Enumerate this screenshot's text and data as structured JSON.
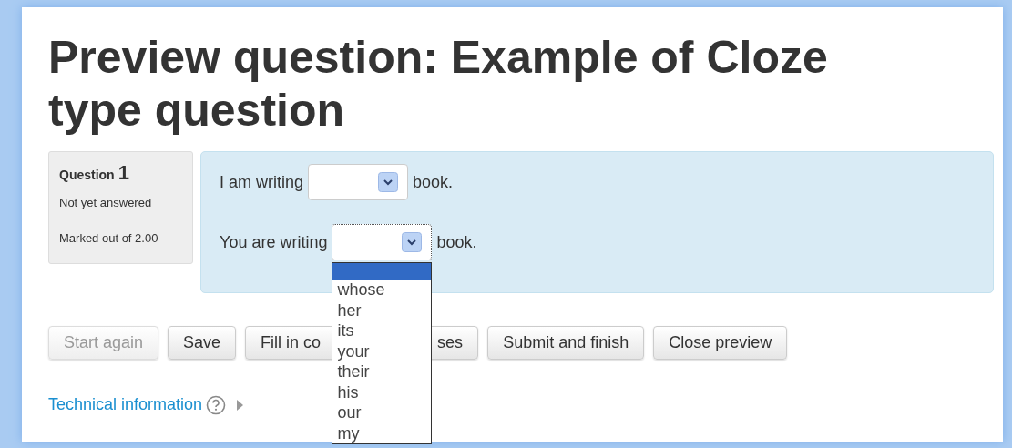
{
  "title": "Preview question: Example of Cloze type question",
  "info": {
    "label": "Question",
    "number": "1",
    "state": "Not yet answered",
    "marks": "Marked out of 2.00"
  },
  "lines": [
    {
      "before": "I am writing",
      "after": "book.",
      "focused": false,
      "open": false
    },
    {
      "before": "You are writing",
      "after": "book.",
      "focused": true,
      "open": true
    }
  ],
  "dropdown": {
    "options": [
      {
        "selected": true
      },
      {
        "label": "whose",
        "selected": false
      },
      {
        "label": "her",
        "selected": false
      },
      {
        "label": "its",
        "selected": false
      },
      {
        "label": "your",
        "selected": false
      },
      {
        "label": "their",
        "selected": false
      },
      {
        "label": "his",
        "selected": false
      },
      {
        "label": "our",
        "selected": false
      },
      {
        "label": "my",
        "selected": false
      }
    ]
  },
  "buttons": [
    {
      "label": "Start again",
      "disabled": true
    },
    {
      "label": "Save",
      "disabled": false
    },
    {
      "label_parts": [
        "Fill in co",
        "ses"
      ],
      "disabled": false
    },
    {
      "label": "Submit and finish",
      "disabled": false
    },
    {
      "label": "Close preview",
      "disabled": false
    }
  ],
  "technical": {
    "label": "Technical information"
  }
}
